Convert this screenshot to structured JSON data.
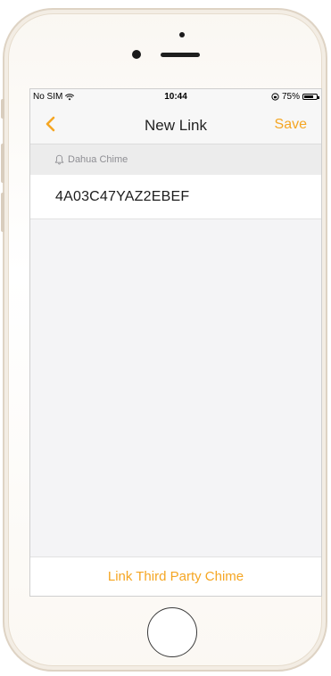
{
  "status_bar": {
    "carrier": "No SIM",
    "time": "10:44",
    "battery_percent": "75%",
    "battery_level": 0.75,
    "icons": [
      "wifi-icon",
      "rotation-lock-icon",
      "battery-icon"
    ]
  },
  "nav": {
    "title": "New Link",
    "save_label": "Save",
    "back_icon": "chevron-left-icon"
  },
  "section": {
    "header": "Dahua Chime",
    "icon": "bell-icon"
  },
  "device": {
    "serial": "4A03C47YAZ2EBEF"
  },
  "footer": {
    "action_label": "Link Third Party Chime"
  },
  "colors": {
    "accent": "#f5a623",
    "background": "#f4f4f6",
    "section_bg": "#ececec"
  }
}
